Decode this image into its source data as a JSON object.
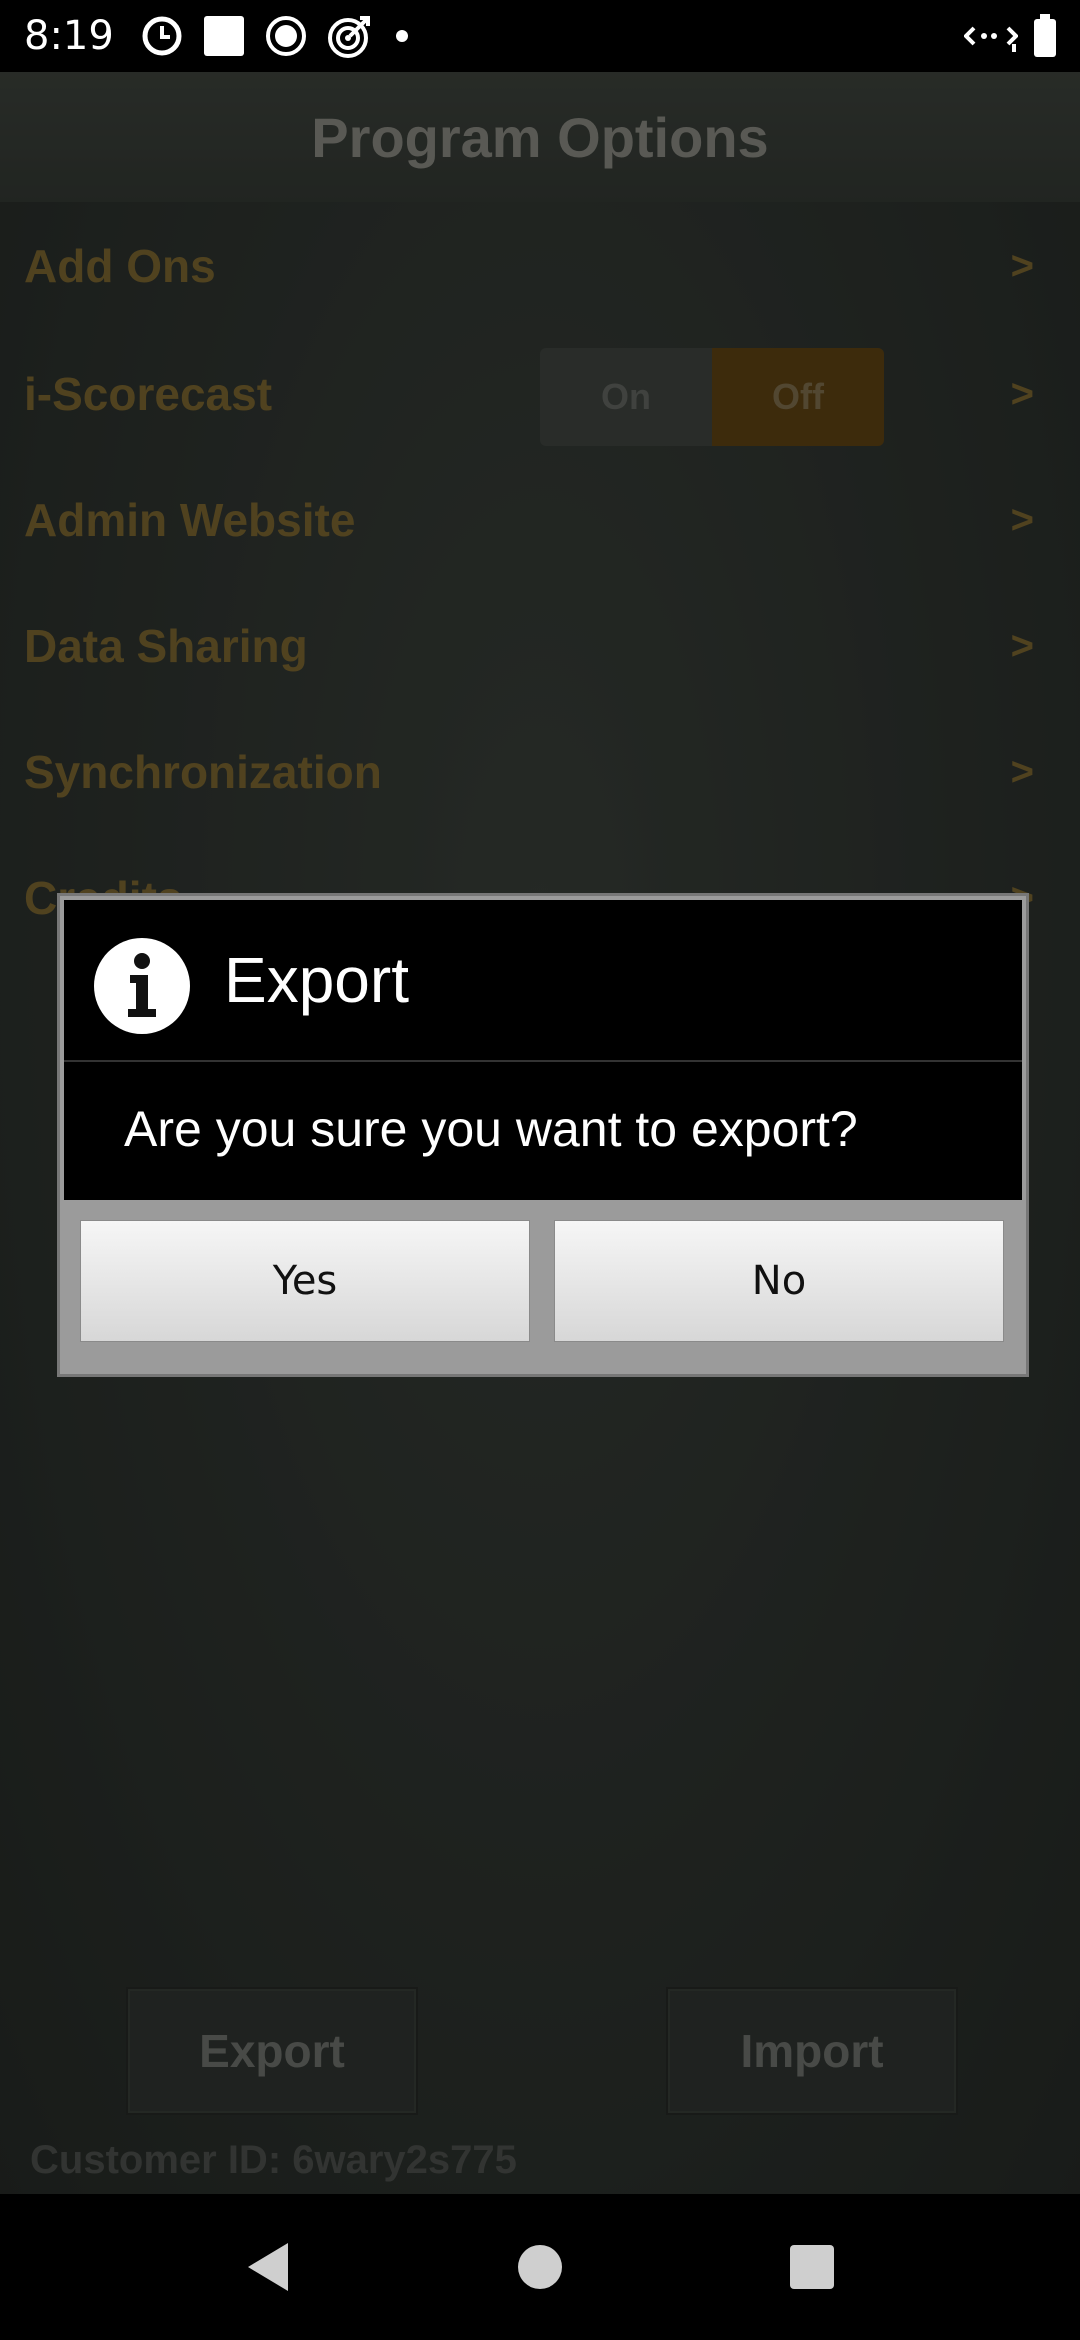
{
  "status_bar": {
    "time": "8:19",
    "icons": [
      "alarm-icon",
      "square-icon",
      "circle-record-icon",
      "target-icon",
      "dot-icon"
    ],
    "right_icons": [
      "data-transfer-icon",
      "battery-icon"
    ]
  },
  "header": {
    "title": "Program Options"
  },
  "options": [
    {
      "label": "Add Ons",
      "chevron": ">"
    },
    {
      "label": "i-Scorecast",
      "chevron": ">"
    },
    {
      "label": "Admin Website",
      "chevron": ">"
    },
    {
      "label": "Data Sharing",
      "chevron": ">"
    },
    {
      "label": "Synchronization",
      "chevron": ">"
    },
    {
      "label": "Credits",
      "chevron": ">"
    }
  ],
  "scorecast_toggle": {
    "on_label": "On",
    "off_label": "Off",
    "selected": "Off"
  },
  "bottom": {
    "export_label": "Export",
    "import_label": "Import",
    "customer_id": "Customer ID: 6wary2s775"
  },
  "dialog": {
    "title": "Export",
    "message": "Are you sure you want to export?",
    "yes_label": "Yes",
    "no_label": "No"
  },
  "colors": {
    "accent_gold": "#8a7236",
    "toggle_selected": "#6a4b15",
    "background": "#363c37"
  }
}
